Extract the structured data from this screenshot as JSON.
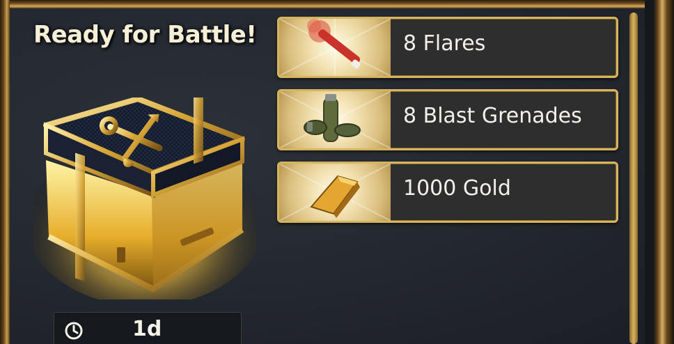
{
  "panel": {
    "title": "Ready for Battle!",
    "chest_icon": "crate-icon",
    "timer": {
      "icon": "clock-icon",
      "value": "1d"
    }
  },
  "rewards": [
    {
      "label": "8 Flares",
      "icon": "flare-icon"
    },
    {
      "label": "8 Blast Grenades",
      "icon": "grenade-icon"
    },
    {
      "label": "1000 Gold",
      "icon": "gold-bar-icon"
    }
  ],
  "colors": {
    "accent_gold": "#d7b45e",
    "panel_bg": "#23272e",
    "card_bg": "#2e2e2f",
    "text": "#f3f1ea"
  }
}
